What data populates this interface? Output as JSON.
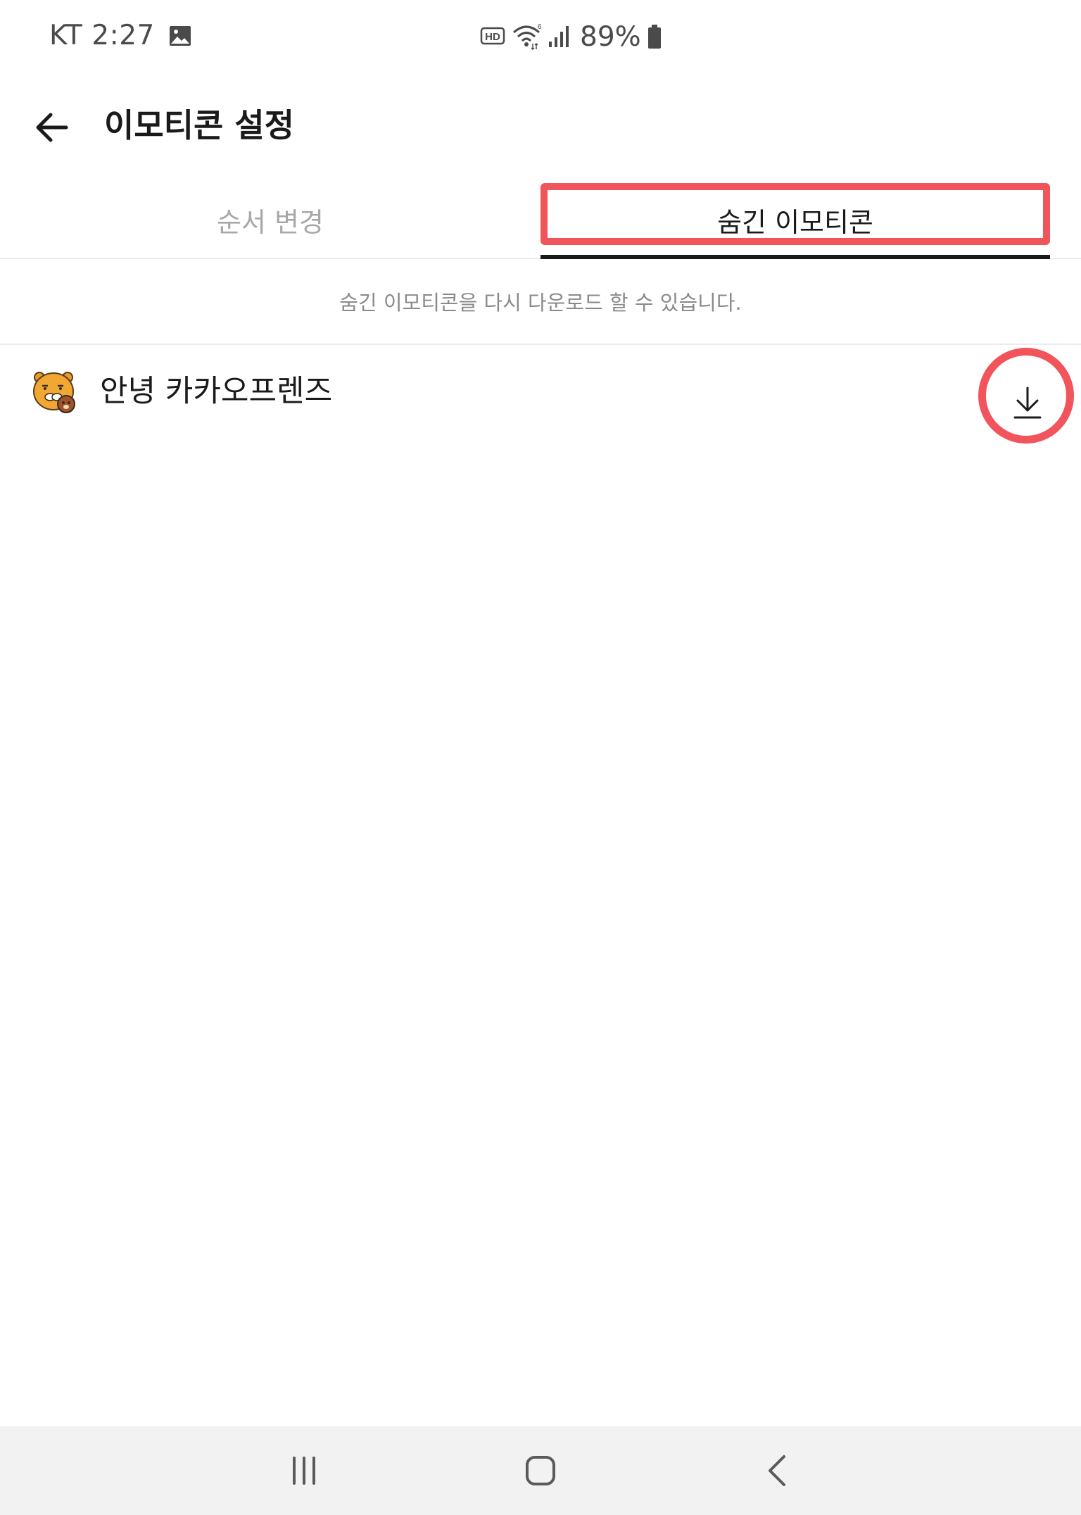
{
  "status_bar": {
    "carrier_time": "KT 2:27",
    "battery": "89%",
    "icons": [
      "gallery-icon",
      "hd-voice-icon",
      "wifi-icon",
      "signal-icon",
      "battery-icon"
    ]
  },
  "header": {
    "title": "이모티콘 설정",
    "back_icon": "arrow-left-icon"
  },
  "tabs": [
    {
      "label": "순서 변경",
      "selected": false
    },
    {
      "label": "숨긴 이모티콘",
      "selected": true
    }
  ],
  "info_note": "숨긴 이모티콘을 다시 다운로드 할 수 있습니다.",
  "hidden_emoticons": [
    {
      "name": "안녕 카카오프렌즈",
      "thumb_icon": "ryan-emoticon-icon",
      "action_icon": "download-icon"
    }
  ],
  "nav_bar": {
    "buttons": [
      "recents-icon",
      "home-icon",
      "back-icon"
    ]
  },
  "colors": {
    "accent_highlight": "#f2545b",
    "text_primary": "#1a1a1a",
    "text_muted": "#8a8a8a",
    "tab_inactive": "#a8a8a8",
    "nav_background": "#f2f2f2"
  }
}
